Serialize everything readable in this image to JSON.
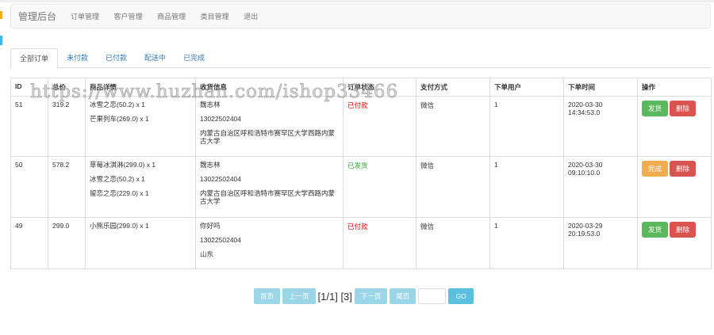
{
  "navbar": {
    "brand": "管理后台",
    "items": [
      "订单管理",
      "客户管理",
      "商品管理",
      "类目管理",
      "退出"
    ]
  },
  "tabs": [
    "全部订单",
    "未付款",
    "已付款",
    "配送中",
    "已完成"
  ],
  "table": {
    "headers": [
      "ID",
      "总价",
      "商品详情",
      "收货信息",
      "订单状态",
      "支付方式",
      "下单用户",
      "下单时间",
      "操作"
    ],
    "rows": [
      {
        "id": "51",
        "total": "319.2",
        "items": [
          "冰雪之恋(50.2) x 1",
          "芒果列车(269.0) x 1"
        ],
        "name": "魏志林",
        "phone": "13022502404",
        "address": "内蒙古自治区呼和浩特市赛罕区大学西路内蒙古大学",
        "status": "已付款",
        "status_color": "#ff0000",
        "pay": "微信",
        "user": "1",
        "date": "2020-03-30",
        "time": "14:34:53.0",
        "action1": "发货",
        "action2": "删除"
      },
      {
        "id": "50",
        "total": "578.2",
        "items": [
          "草莓冰淇淋(299.0) x 1",
          "冰雪之恋(50.2) x 1",
          "留恋之恋(229.0) x 1"
        ],
        "name": "魏志林",
        "phone": "13022502404",
        "address": "内蒙古自治区呼和浩特市赛罕区大学西路内蒙古大学",
        "status": "已发货",
        "status_color": "#33aa33",
        "pay": "微信",
        "user": "1",
        "date": "2020-03-30",
        "time": "09:10:10.0",
        "action1": "完成",
        "action2": "删除"
      },
      {
        "id": "49",
        "total": "299.0",
        "items": [
          "小熊乐园(299.0) x 1"
        ],
        "name": "你好吗",
        "phone": "13022502404",
        "address": "山东",
        "status": "已付款",
        "status_color": "#ff0000",
        "pay": "微信",
        "user": "1",
        "date": "2020-03-29",
        "time": "20:19:53.0",
        "action1": "发货",
        "action2": "删除"
      }
    ]
  },
  "pager": {
    "first": "首页",
    "prev": "上一页",
    "info": "[1/1] [3]",
    "next": "下一页",
    "last": "尾页",
    "go": "GO",
    "input_value": ""
  },
  "watermark": "https://www.huzhan.com/ishop33466"
}
